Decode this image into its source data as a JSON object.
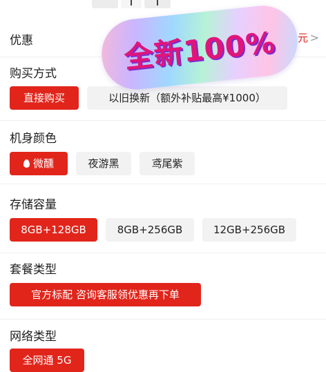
{
  "promo": {
    "title": "优惠",
    "right_text": "元",
    "chevron": ">"
  },
  "sticker": {
    "text": "全新100%"
  },
  "purchase": {
    "title": "购买方式",
    "options": [
      "直接购买",
      "以旧换新（额外补贴最高¥1000）"
    ],
    "selected": 0
  },
  "color": {
    "title": "机身颜色",
    "options": [
      "微醺",
      "夜游黑",
      "鸢尾紫"
    ],
    "selected": 0
  },
  "storage": {
    "title": "存储容量",
    "options": [
      "8GB+128GB",
      "8GB+256GB",
      "12GB+256GB"
    ],
    "selected": 0
  },
  "package": {
    "title": "套餐类型",
    "options": [
      "官方标配 咨询客服领优惠再下单"
    ],
    "selected": 0
  },
  "network": {
    "title": "网络类型",
    "options": [
      "全网通 5G"
    ],
    "selected": 0
  },
  "colors": {
    "accent": "#e1251b",
    "chip_bg": "#f2f2f2",
    "sticker_text": "#e0157a"
  }
}
